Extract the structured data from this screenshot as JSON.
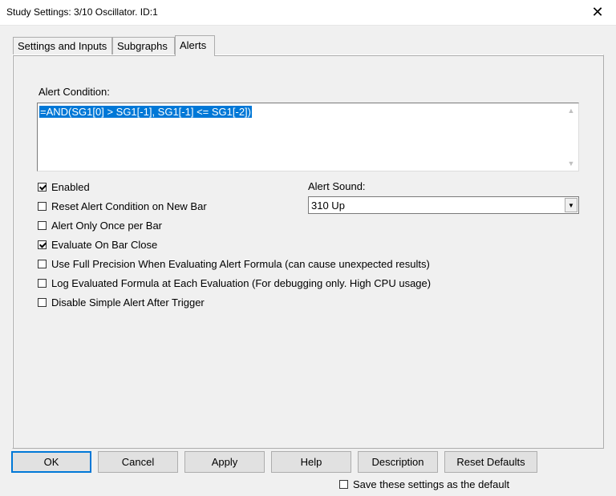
{
  "window": {
    "title": "Study Settings: 3/10 Oscillator. ID:1",
    "close_glyph": "✕"
  },
  "tabs": [
    {
      "label": "Settings and Inputs",
      "active": false
    },
    {
      "label": "Subgraphs",
      "active": false
    },
    {
      "label": "Alerts",
      "active": true
    }
  ],
  "alerts": {
    "condition_label": "Alert Condition:",
    "condition_value": "=AND(SG1[0] > SG1[-1], SG1[-1] <= SG1[-2])",
    "sound_label": "Alert Sound:",
    "sound_value": "310 Up",
    "options": [
      {
        "label": "Enabled",
        "checked": true
      },
      {
        "label": "Reset Alert Condition on New Bar",
        "checked": false
      },
      {
        "label": "Alert Only Once per Bar",
        "checked": false
      },
      {
        "label": "Evaluate On Bar Close",
        "checked": true
      },
      {
        "label": "Use Full Precision When Evaluating Alert Formula (can cause unexpected results)",
        "checked": false
      },
      {
        "label": "Log Evaluated Formula at Each Evaluation (For debugging only. High CPU usage)",
        "checked": false
      },
      {
        "label": "Disable Simple Alert After Trigger",
        "checked": false
      }
    ]
  },
  "buttons": {
    "ok": "OK",
    "cancel": "Cancel",
    "apply": "Apply",
    "help": "Help",
    "description": "Description",
    "reset_defaults": "Reset Defaults"
  },
  "footer": {
    "save_default_label": "Save these settings as the default",
    "save_default_checked": false
  },
  "colors": {
    "selection": "#0078d7",
    "dialog_bg": "#f0f0f0"
  }
}
